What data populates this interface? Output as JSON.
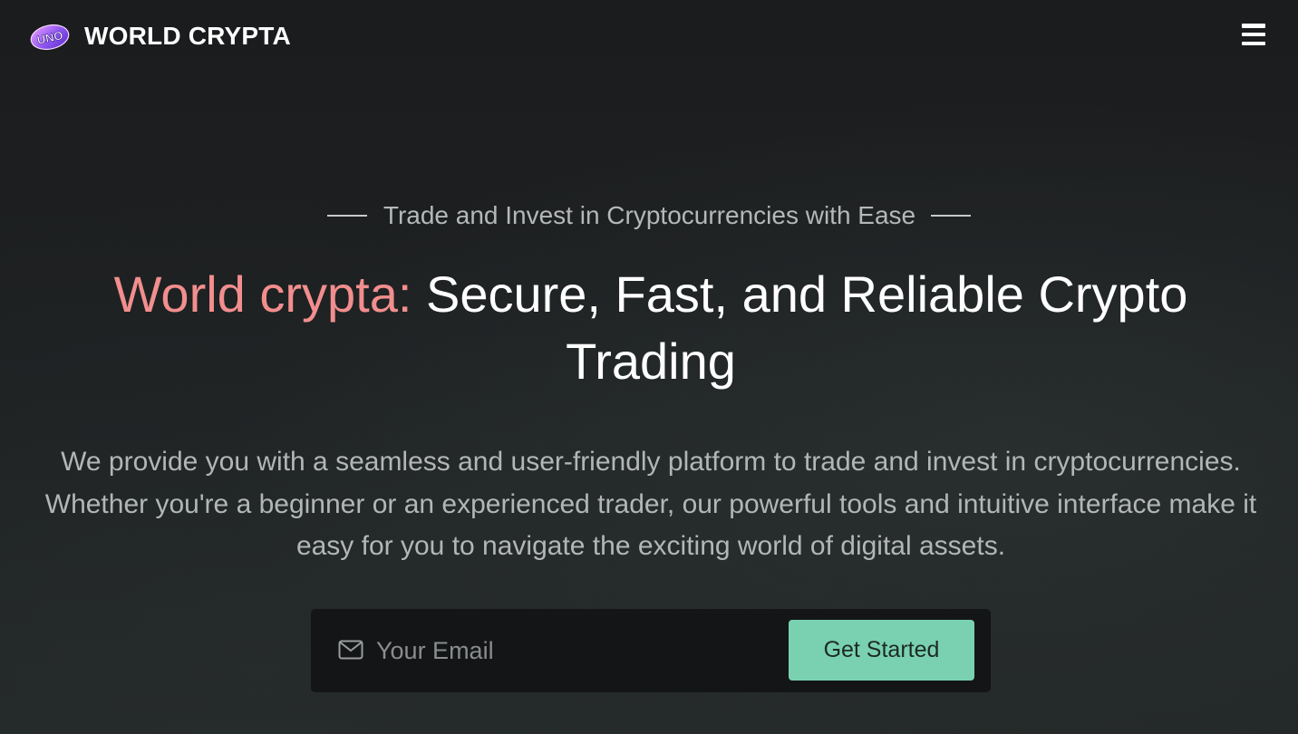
{
  "header": {
    "logo_badge_text": "UNO",
    "brand_name": "WORLD CRYPTA",
    "menu_icon": "hamburger-menu-icon"
  },
  "hero": {
    "eyebrow": "Trade and Invest in Cryptocurrencies with Ease",
    "headline_accent": "World crypta:",
    "headline_rest": "Secure, Fast, and Reliable Crypto Trading",
    "description": "We provide you with a seamless and user-friendly platform to trade and invest in cryptocurrencies. Whether you're a beginner or an experienced trader, our powerful tools and intuitive interface make it easy for you to navigate the exciting world of digital assets."
  },
  "signup": {
    "email_placeholder": "Your Email",
    "email_value": "",
    "mail_icon": "envelope-icon",
    "cta_label": "Get Started"
  },
  "colors": {
    "background": "#1c1e20",
    "accent_text": "#f28e8e",
    "cta_background": "#79d1b1",
    "form_background": "#131516"
  }
}
